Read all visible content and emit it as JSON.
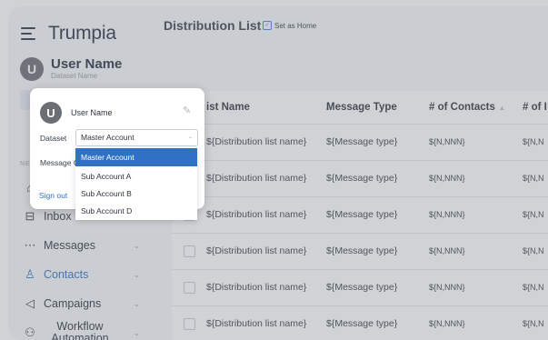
{
  "brand": {
    "name": "Trumpia"
  },
  "sidebar": {
    "user_initial": "U",
    "user_name": "User Name",
    "dataset_label": "Dataset Name",
    "nav_section_label": "NE",
    "items": [
      {
        "label": "Inbox",
        "icon": "inbox-icon"
      },
      {
        "label": "Messages",
        "icon": "chat-icon"
      },
      {
        "label": "Contacts",
        "icon": "person-icon",
        "active": true
      },
      {
        "label": "Campaigns",
        "icon": "megaphone-icon"
      },
      {
        "label": "Workflow Automation",
        "icon": "workflow-icon"
      }
    ]
  },
  "main": {
    "title": "Distribution List",
    "set_home_label": "Set as Home",
    "table": {
      "headers": [
        "ist Name",
        "Message Type",
        "# of Contacts",
        "# of I"
      ],
      "rows": [
        [
          "${Distribution list name}",
          "${Message type}",
          "${N,NNN}",
          "${N,N"
        ],
        [
          "${Distribution list name}",
          "${Message type}",
          "${N,NNN}",
          "${N,N"
        ],
        [
          "${Distribution list name}",
          "${Message type}",
          "${N,NNN}",
          "${N,N"
        ],
        [
          "${Distribution list name}",
          "${Message type}",
          "${N,NNN}",
          "${N,N"
        ],
        [
          "${Distribution list name}",
          "${Message type}",
          "${N,NNN}",
          "${N,N"
        ],
        [
          "${Distribution list name}",
          "${Message type}",
          "${N,NNN}",
          "${N,N"
        ]
      ]
    }
  },
  "popover": {
    "user_initial": "U",
    "user_name": "User Name",
    "dataset_label": "Dataset",
    "dataset_value": "Master Account",
    "message_label": "Message C",
    "sign_out": "Sign out",
    "options": [
      "Master Account",
      "Sub Account A",
      "Sub Account B",
      "Sub Account D"
    ],
    "selected_index": 0
  },
  "colors": {
    "accent": "#2f72c4",
    "avatar": "#6b6e72"
  }
}
